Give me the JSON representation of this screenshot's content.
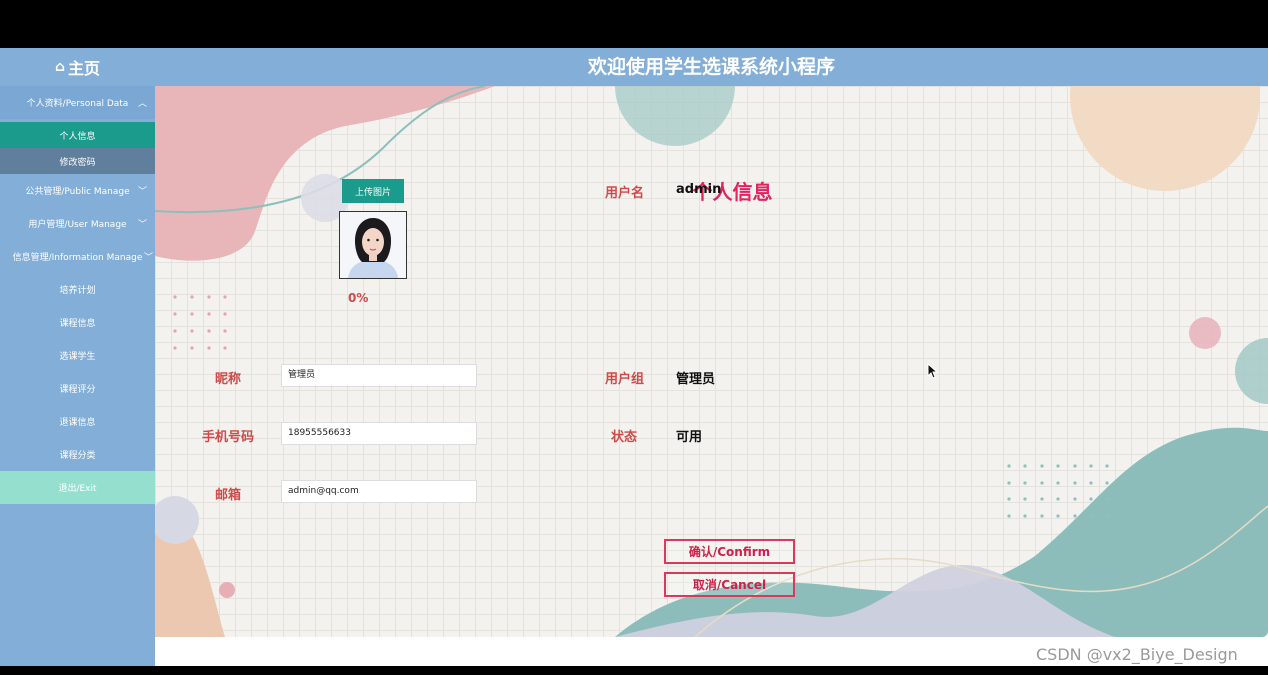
{
  "header": {
    "home_label": "主页",
    "home_icon": "home-icon",
    "app_title": "欢迎使用学生选课系统小程序"
  },
  "sidebar": {
    "groups": [
      {
        "label": "个人资料/Personal Data",
        "expanded": true
      },
      {
        "label": "公共管理/Public Manage",
        "expanded": false
      },
      {
        "label": "用户管理/User Manage",
        "expanded": false
      },
      {
        "label": "信息管理/Information Manage",
        "expanded": false
      }
    ],
    "personal_items": [
      "个人信息",
      "修改密码"
    ],
    "info_items": [
      "培养计划",
      "课程信息",
      "选课学生",
      "课程评分",
      "退课信息",
      "课程分类"
    ],
    "exit_label": "退出/Exit"
  },
  "profile": {
    "title": "个人信息",
    "upload_label": "上传图片",
    "progress": "0%",
    "nickname_label": "昵称",
    "nickname_value": "管理员",
    "phone_label": "手机号码",
    "phone_value": "18955556633",
    "email_label": "邮箱",
    "email_value": "admin@qq.com",
    "username_label": "用户名",
    "username_value": "admin",
    "group_label": "用户组",
    "group_value": "管理员",
    "status_label": "状态",
    "status_value": "可用",
    "confirm_label": "确认/Confirm",
    "cancel_label": "取消/Cancel"
  },
  "watermark": "CSDN @vx2_Biye_Design",
  "colors": {
    "header_bg": "#82aed8",
    "active_item": "#1a9b8c",
    "exit_bg": "#95dfcf",
    "label_red": "#d04a4a",
    "title_pink": "#e0245e"
  }
}
